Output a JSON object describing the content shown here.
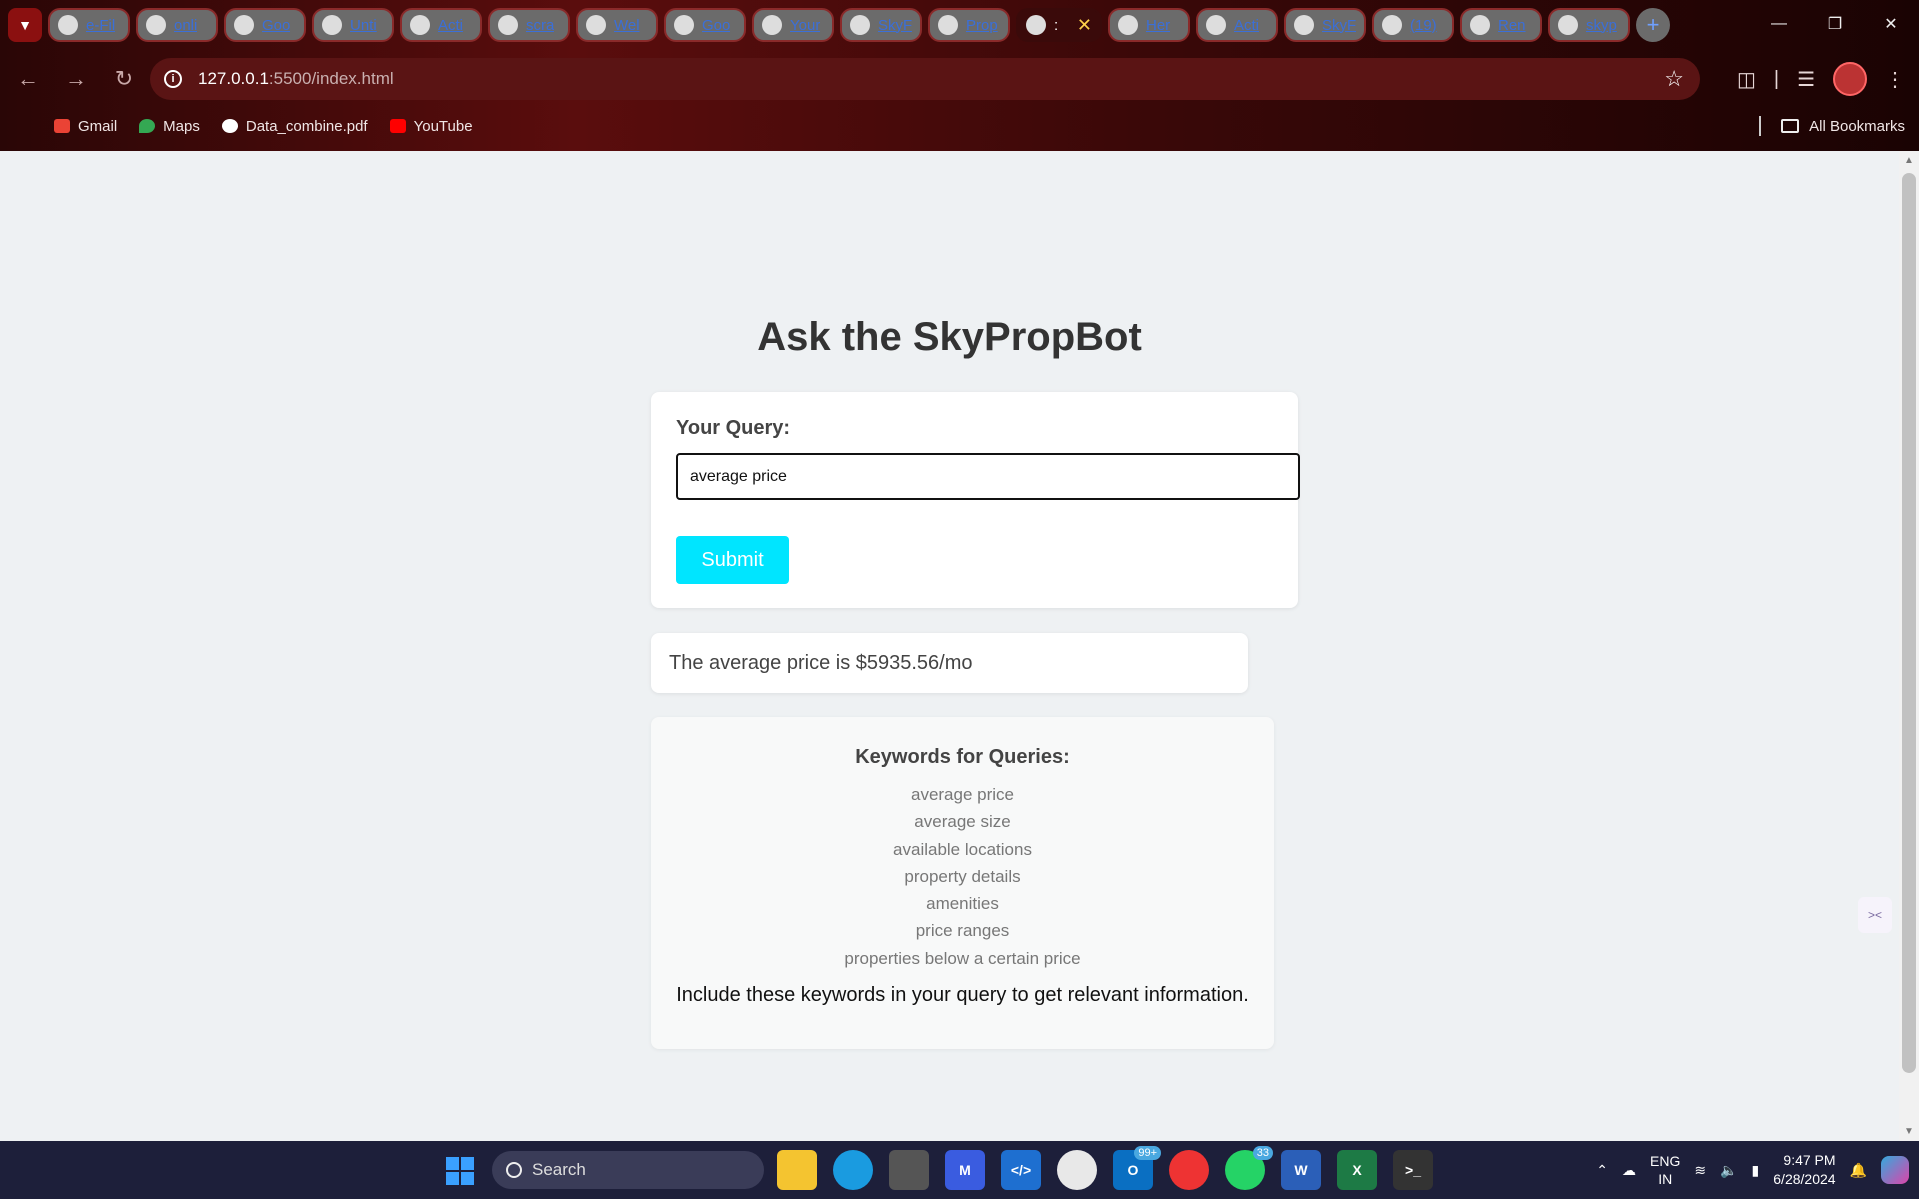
{
  "browser": {
    "tabs": [
      {
        "title": "e-Fil"
      },
      {
        "title": "onli"
      },
      {
        "title": "Goo"
      },
      {
        "title": "Unti"
      },
      {
        "title": "Acti"
      },
      {
        "title": "scra"
      },
      {
        "title": "Wel"
      },
      {
        "title": "Goo"
      },
      {
        "title": "Your"
      },
      {
        "title": "SkyF"
      },
      {
        "title": "Prop"
      },
      {
        "title": ":"
      },
      {
        "title": "Her"
      },
      {
        "title": "Acti"
      },
      {
        "title": "SkyF"
      },
      {
        "title": "(19)"
      },
      {
        "title": "Ren"
      },
      {
        "title": "skyp"
      }
    ],
    "active_tab_index": 11,
    "url_host": "127.0.0.1",
    "url_path": ":5500/index.html",
    "bookmarks": [
      {
        "label": "Gmail",
        "color": "#ea4335"
      },
      {
        "label": "Maps",
        "color": "#34a853"
      },
      {
        "label": "Data_combine.pdf",
        "color": "#ffffff"
      },
      {
        "label": "YouTube",
        "color": "#ff0000"
      }
    ],
    "all_bookmarks_label": "All Bookmarks"
  },
  "page": {
    "title": "Ask the SkyPropBot",
    "query_label": "Your Query:",
    "query_value": "average price",
    "submit_label": "Submit",
    "answer": "The average price is $5935.56/mo",
    "keywords_title": "Keywords for Queries:",
    "keywords": [
      "average price",
      "average size",
      "available locations",
      "property details",
      "amenities",
      "price ranges",
      "properties below a certain price"
    ],
    "keywords_note": "Include these keywords in your query to get relevant information.",
    "accent_color": "#00e5ff"
  },
  "taskbar": {
    "search_label": "Search",
    "outlook_badge": "99+",
    "whatsapp_badge": "33",
    "lang_line1": "ENG",
    "lang_line2": "IN",
    "time": "9:47 PM",
    "date": "6/28/2024"
  }
}
